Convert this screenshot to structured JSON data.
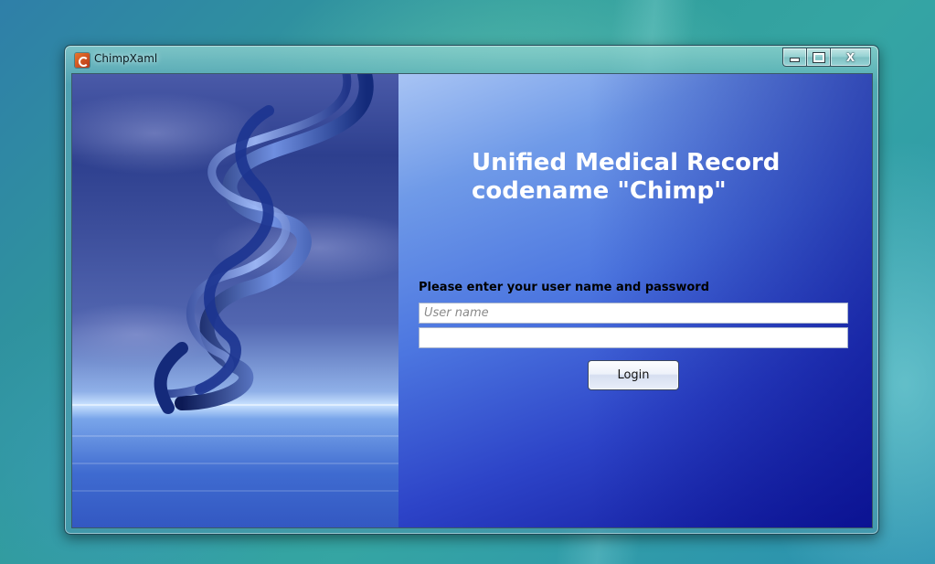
{
  "window": {
    "title": "ChimpXaml",
    "app_icon": "chimpxaml-app-icon",
    "caption_buttons": {
      "minimize": "minimize-icon",
      "maximize": "maximize-icon",
      "close": "X"
    }
  },
  "login": {
    "heading_line1": "Unified Medical Record",
    "heading_line2": "codename \"Chimp\"",
    "prompt": "Please enter your user name and password",
    "username_placeholder": "User name",
    "username_value": "",
    "password_value": "",
    "login_label": "Login"
  },
  "colors": {
    "heading_text": "#ffffff",
    "panel_gradient_start": "#a8c4f4",
    "panel_gradient_end": "#0f179a",
    "desktop_teal": "#2f9c9a"
  }
}
